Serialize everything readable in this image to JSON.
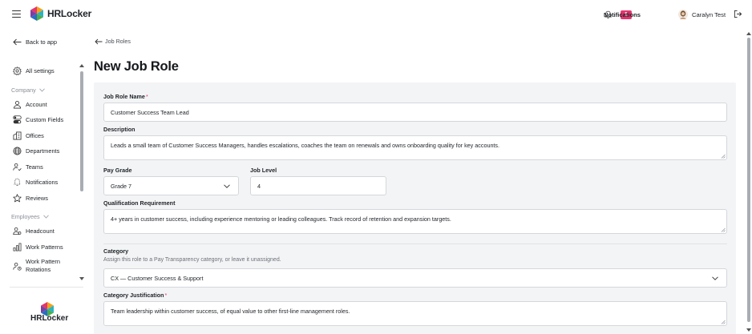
{
  "app": {
    "brand": "HRLocker"
  },
  "topbar": {
    "notifications_label": "Notifications",
    "notifications_count": "1",
    "user_name": "Caralyn Test"
  },
  "sidebar": {
    "back_label": "Back to app",
    "all_settings": "All settings",
    "company_header": "Company",
    "company_items": [
      "Account",
      "Custom Fields",
      "Offices",
      "Departments",
      "Teams",
      "Notifications",
      "Reviews"
    ],
    "employees_header": "Employees",
    "employee_items": [
      "Headcount",
      "Work Patterns",
      "Work Pattern Rotations"
    ]
  },
  "breadcrumb": {
    "label": "Job Roles"
  },
  "page": {
    "title": "New Job Role"
  },
  "form": {
    "name_label": "Job Role Name",
    "name_value": "Customer Success Team Lead",
    "description_label": "Description",
    "description_value": "Leads a small team of Customer Success Managers, handles escalations, coaches the team on renewals and owns onboarding quality for key accounts.",
    "pay_grade_label": "Pay Grade",
    "pay_grade_value": "Grade 7",
    "job_level_label": "Job Level",
    "job_level_value": "4",
    "qualification_label": "Qualification Requirement",
    "qualification_value": "4+ years in customer success, including experience mentoring or leading colleagues. Track record of retention and expansion targets.",
    "category_label": "Category",
    "category_help": "Assign this role to a Pay Transparency category, or leave it unassigned.",
    "category_value": "CX — Customer Success & Support",
    "justification_label": "Category Justification",
    "justification_value": "Team leadership within customer success, of equal value to other first-line management roles.",
    "required_mark": "*"
  },
  "colors": {
    "accent": "#e5356e",
    "panel": "#f3f4f5",
    "border": "#d4d7db"
  },
  "icons": {
    "menu": "hamburger-icon",
    "bell": "bell-icon",
    "logout": "logout-icon",
    "back": "arrow-left-icon",
    "settings": "gear-icon",
    "account": "user-icon",
    "custom_fields": "toggle-icon",
    "offices": "building-icon",
    "departments": "globe-icon",
    "teams": "team-icon",
    "notifications": "bell-outline-icon",
    "reviews": "star-icon",
    "headcount": "people-icon",
    "work_patterns": "bar-chart-icon",
    "rotations": "rotation-icon"
  }
}
